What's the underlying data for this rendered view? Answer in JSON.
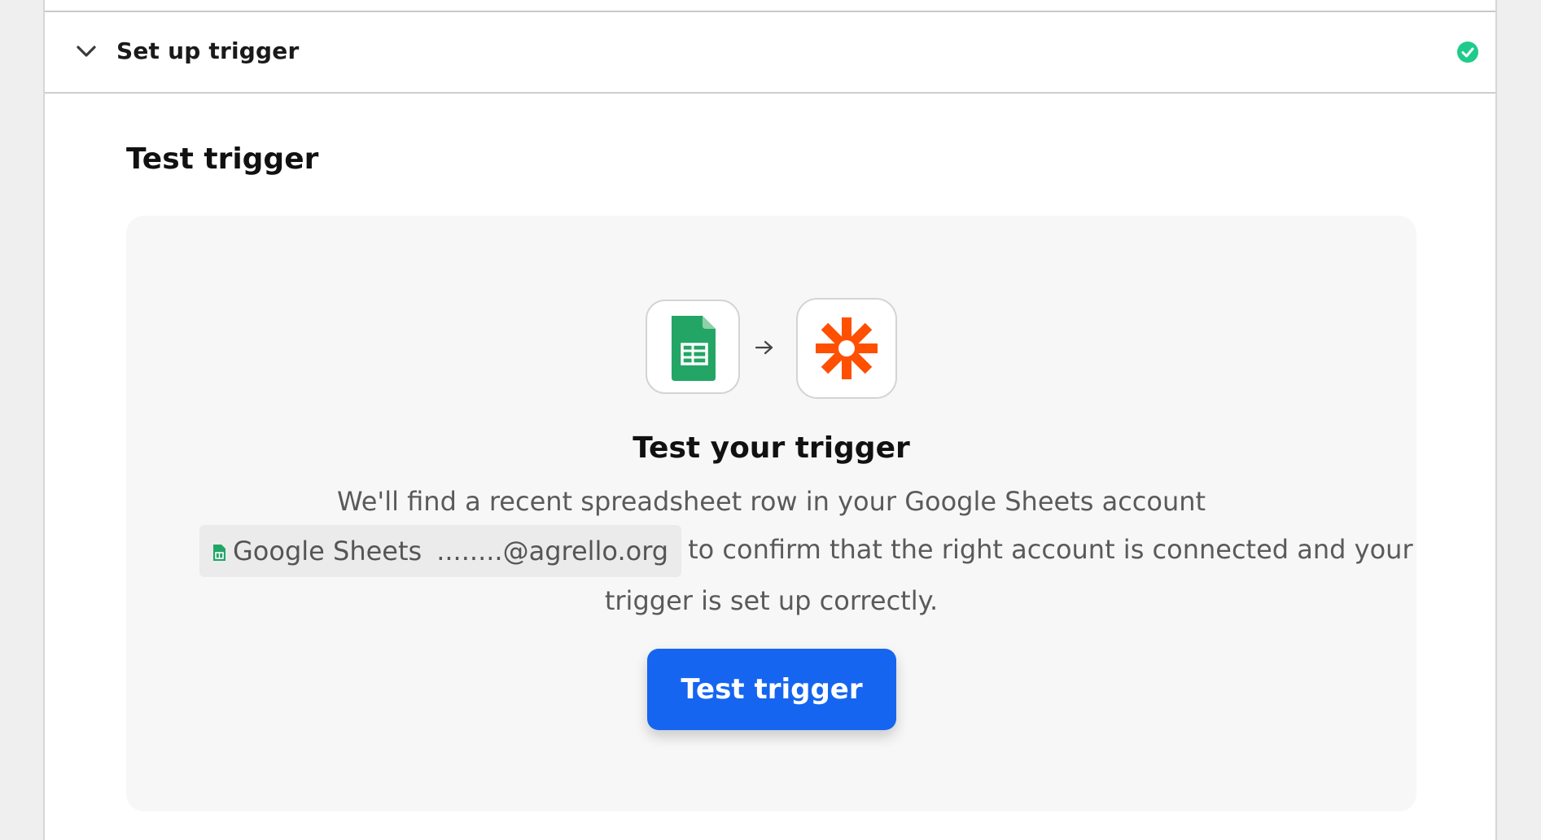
{
  "step": {
    "title": "Set up trigger",
    "status": "complete"
  },
  "section": {
    "title": "Test trigger"
  },
  "card": {
    "title": "Test your trigger",
    "description_line1": "We'll find a recent spreadsheet row in your Google Sheets account",
    "account_app": "Google Sheets",
    "account_email": "........@agrello.org",
    "description_line2_suffix": "to confirm that the right account is connected and your",
    "description_line3": "trigger is set up correctly.",
    "button_label": "Test trigger"
  },
  "icons": {
    "source_app": "google-sheets-icon",
    "target_app": "zapier-icon",
    "flow": "arrow-right-icon"
  },
  "colors": {
    "primary": "#1565f0",
    "success": "#1fcb8a",
    "sheets_green": "#23a566",
    "zapier_orange": "#ff4f00"
  }
}
